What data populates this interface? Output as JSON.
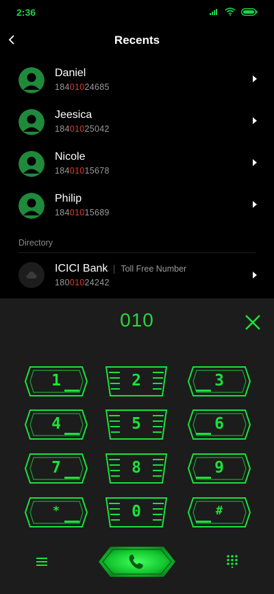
{
  "status": {
    "time": "2:36"
  },
  "header": {
    "title": "Recents"
  },
  "recents": [
    {
      "name": "Daniel",
      "num_pre": "184",
      "num_hl": "010",
      "num_post": "24685"
    },
    {
      "name": "Jeesica",
      "num_pre": "184",
      "num_hl": "010",
      "num_post": "25042"
    },
    {
      "name": "Nicole",
      "num_pre": "184",
      "num_hl": "010",
      "num_post": "15678"
    },
    {
      "name": "Philip",
      "num_pre": "184",
      "num_hl": "010",
      "num_post": "15689"
    }
  ],
  "directory": {
    "label": "Directory",
    "entry": {
      "name": "ICICI Bank",
      "tag": "Toll Free Number",
      "num_pre": "180",
      "num_hl": "010",
      "num_post": "24242"
    }
  },
  "dialer": {
    "dialed": "010",
    "keys": [
      "1",
      "2",
      "3",
      "4",
      "5",
      "6",
      "7",
      "8",
      "9",
      "*",
      "0",
      "#"
    ]
  },
  "colors": {
    "accent": "#19e33a",
    "highlight": "#e03a2a",
    "background": "#000000",
    "dialer_bg": "#1c1c1c"
  }
}
